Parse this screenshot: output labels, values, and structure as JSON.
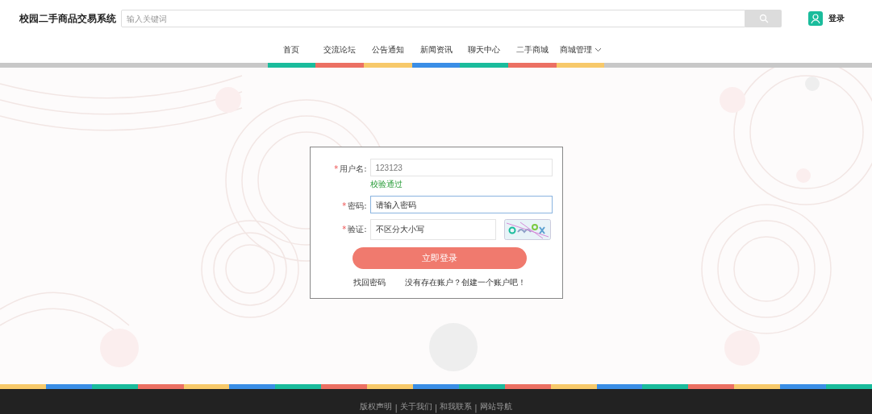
{
  "header": {
    "title": "校园二手商品交易系统",
    "search": {
      "placeholder": "输入关键词"
    },
    "login_link": "登录"
  },
  "nav": [
    {
      "label": "首页",
      "color": "#1abc9c",
      "dropdown": false
    },
    {
      "label": "交流论坛",
      "color": "#ec7063",
      "dropdown": false
    },
    {
      "label": "公告通知",
      "color": "#f7c96a",
      "dropdown": false
    },
    {
      "label": "新闻资讯",
      "color": "#3a8ee6",
      "dropdown": false
    },
    {
      "label": "聊天中心",
      "color": "#1abc9c",
      "dropdown": false
    },
    {
      "label": "二手商城",
      "color": "#ec7063",
      "dropdown": false
    },
    {
      "label": "商城管理",
      "color": "#f7c96a",
      "dropdown": true
    }
  ],
  "login_form": {
    "fields": [
      {
        "kind": "text",
        "label": "用户名:",
        "mark": "*",
        "value": "123123",
        "focused": false,
        "message": "校验通过"
      },
      {
        "kind": "password",
        "label": "密码:",
        "mark": "*",
        "placeholder": "请输入密码",
        "focused": true
      },
      {
        "kind": "captcha",
        "label": "验证:",
        "mark": "*",
        "value": "不区分大小写",
        "focused": false
      }
    ],
    "submit": "立即登录",
    "links": [
      "找回密码",
      "没有存在账户？创建一个账户吧！"
    ]
  },
  "footer": {
    "links": [
      "版权声明",
      "关于我们",
      "和我联系",
      "网站导航"
    ],
    "separator": "|"
  }
}
